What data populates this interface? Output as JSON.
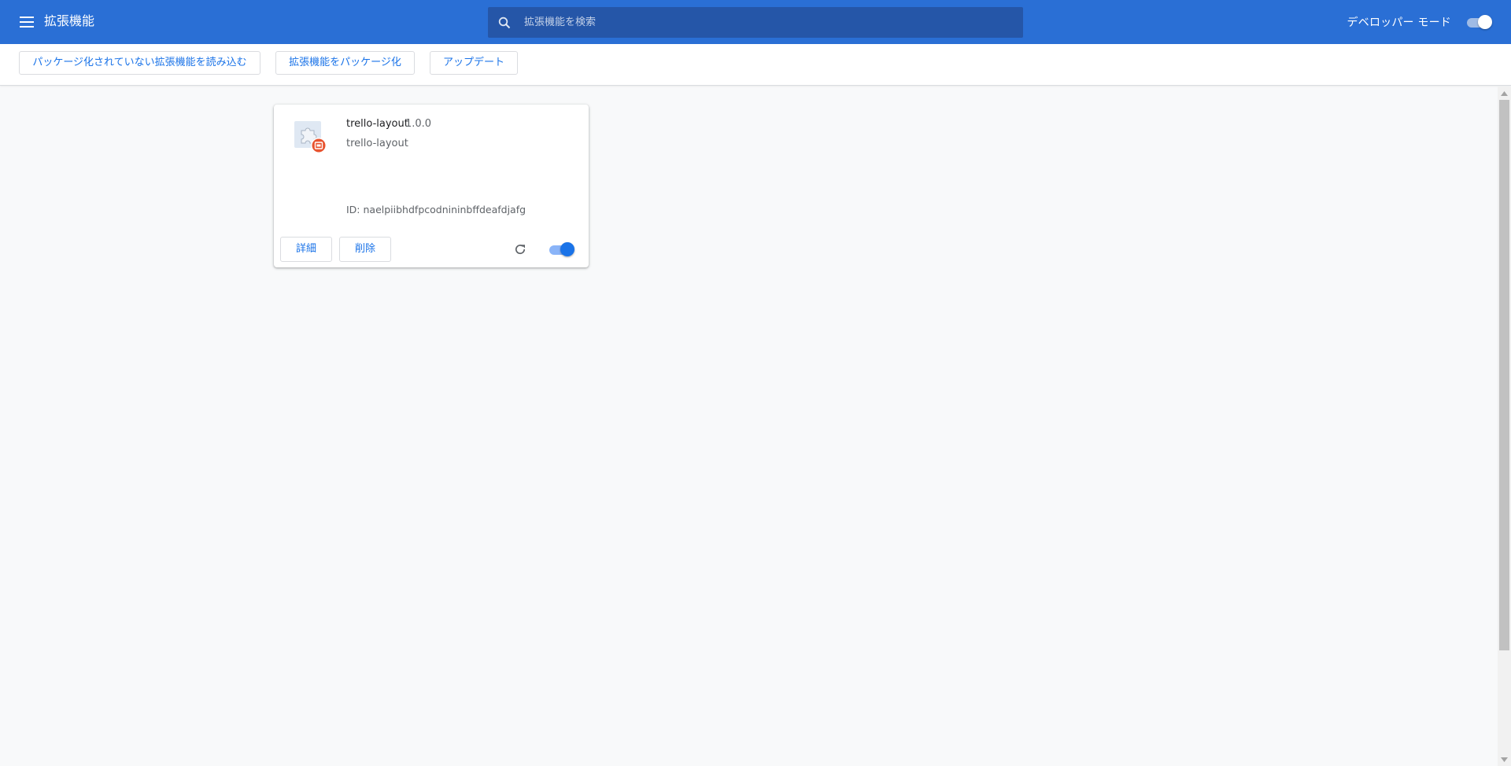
{
  "header": {
    "title": "拡張機能",
    "search_placeholder": "拡張機能を検索",
    "dev_mode_label": "デベロッパー モード",
    "dev_mode_on": true
  },
  "toolbar": {
    "load_unpacked": "パッケージ化されていない拡張機能を読み込む",
    "pack_extension": "拡張機能をパッケージ化",
    "update": "アップデート"
  },
  "extension": {
    "name": "trello-layout",
    "version": "1.0.0",
    "description": "trello-layout",
    "id_text": "ID: naelpiibhdfpcodnininbffdeafdjafg",
    "details_label": "詳細",
    "remove_label": "削除",
    "enabled": true,
    "icon": "puzzle-icon",
    "badge_icon": "developer-badge-icon"
  },
  "colors": {
    "header_bg": "#2a6fd5",
    "search_bg": "#2556a8",
    "accent": "#1a73e8",
    "page_bg": "#f8f9fa",
    "badge": "#e8532f"
  }
}
